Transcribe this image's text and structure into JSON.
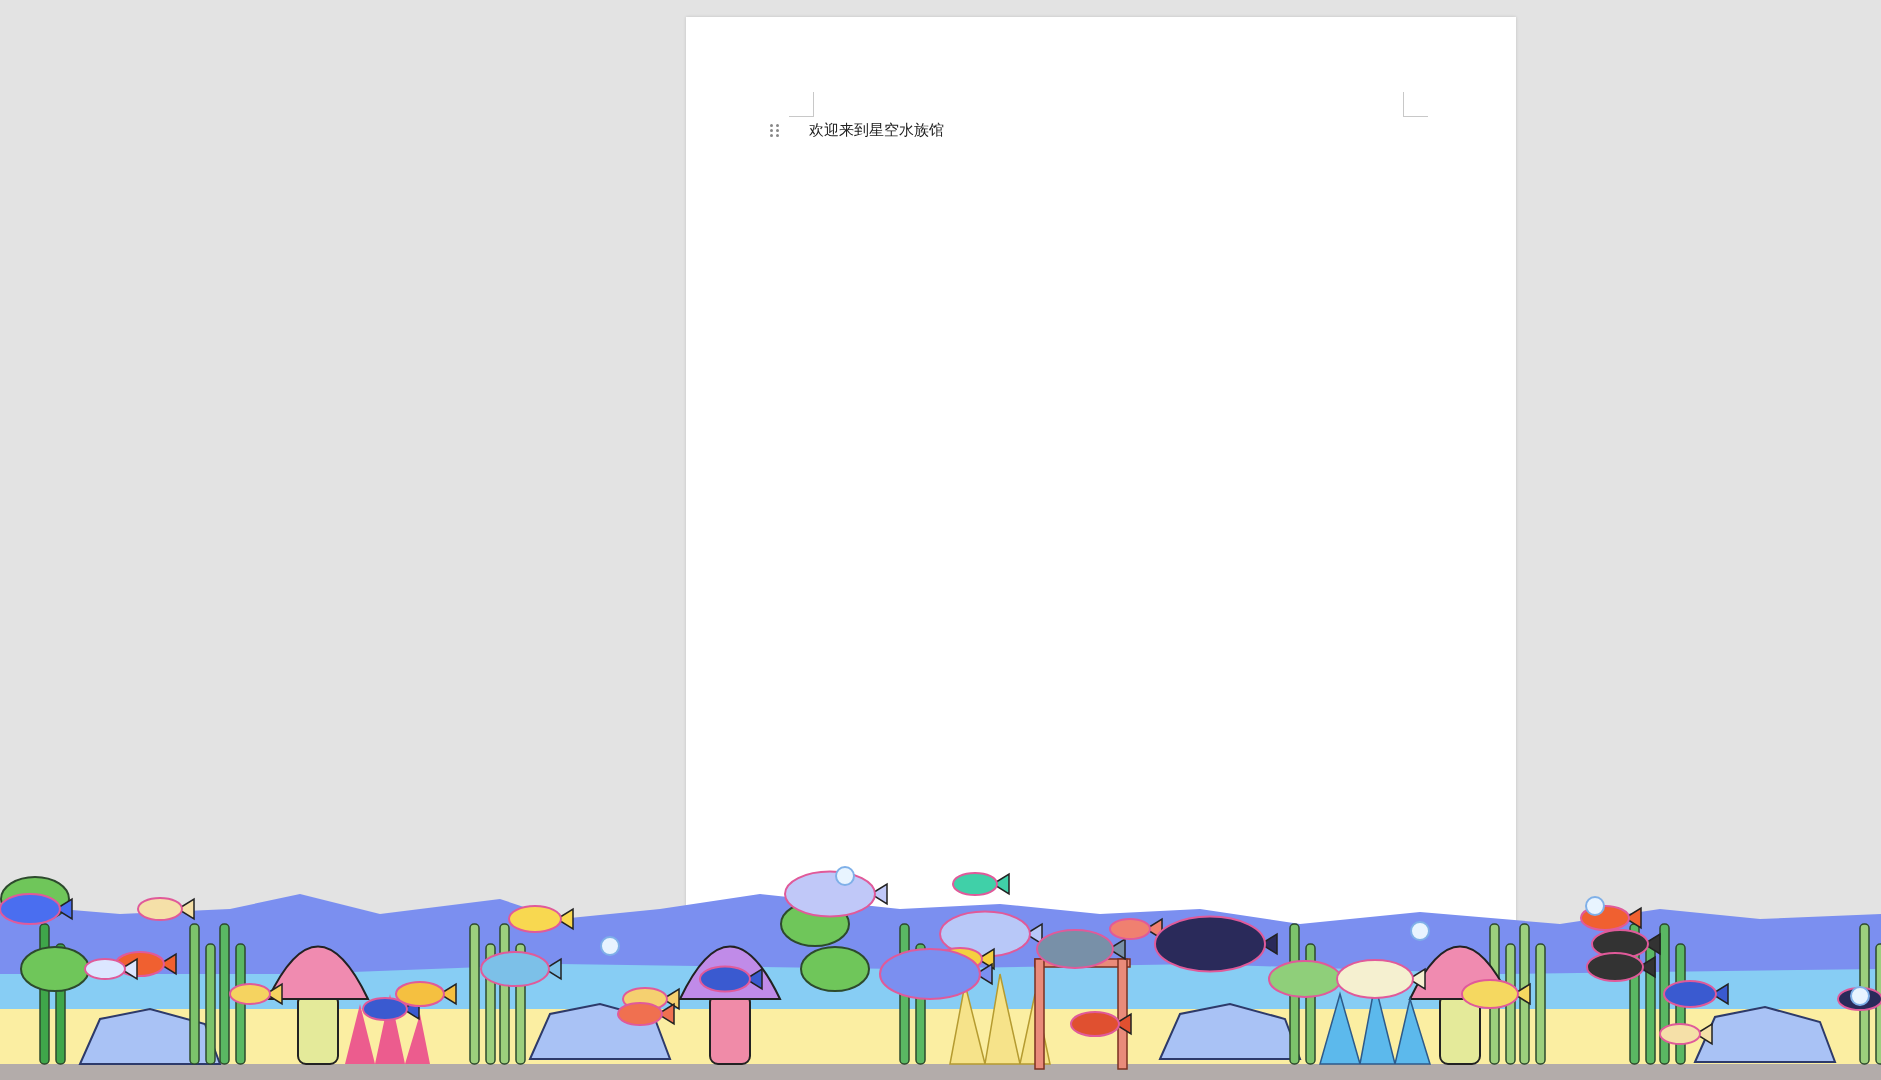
{
  "document": {
    "paragraphs": [
      {
        "text": "欢迎来到星空水族馆"
      }
    ]
  }
}
